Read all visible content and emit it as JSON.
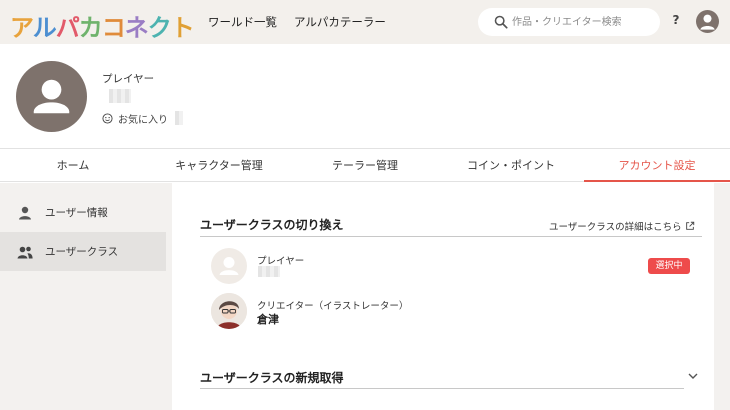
{
  "header": {
    "logo": "アルパカコネクト",
    "logo_colors": [
      "#e8a33d",
      "#4d8fd1",
      "#e25a6a",
      "#6fb36c",
      "#e08b3a",
      "#9a7dc4",
      "#4db3b0",
      "#e0a035"
    ],
    "nav": [
      "ワールド一覧",
      "アルパカテーラー"
    ],
    "search_placeholder": "作品・クリエイター検索",
    "help_label": "?"
  },
  "profile": {
    "role": "プレイヤー",
    "favorites_label": "お気に入り"
  },
  "tabs": [
    "ホーム",
    "キャラクター管理",
    "テーラー管理",
    "コイン・ポイント",
    "アカウント設定"
  ],
  "active_tab": "アカウント設定",
  "sidebar": {
    "items": [
      {
        "label": "ユーザー情報",
        "icon": "person-icon"
      },
      {
        "label": "ユーザークラス",
        "icon": "people-icon"
      }
    ],
    "active": "ユーザークラス"
  },
  "main": {
    "switch_title": "ユーザークラスの切り換え",
    "detail_link": "ユーザークラスの詳細はこちら",
    "classes": [
      {
        "role": "プレイヤー",
        "name": "",
        "badge": "選択中"
      },
      {
        "role": "クリエイター（イラストレーター）",
        "name": "倉津"
      }
    ],
    "acquire_title": "ユーザークラスの新規取得"
  },
  "colors": {
    "accent": "#e5554a",
    "badge": "#ee4b4b",
    "header_bg": "#f3f0ec",
    "avatar_bg": "#7e726c"
  }
}
